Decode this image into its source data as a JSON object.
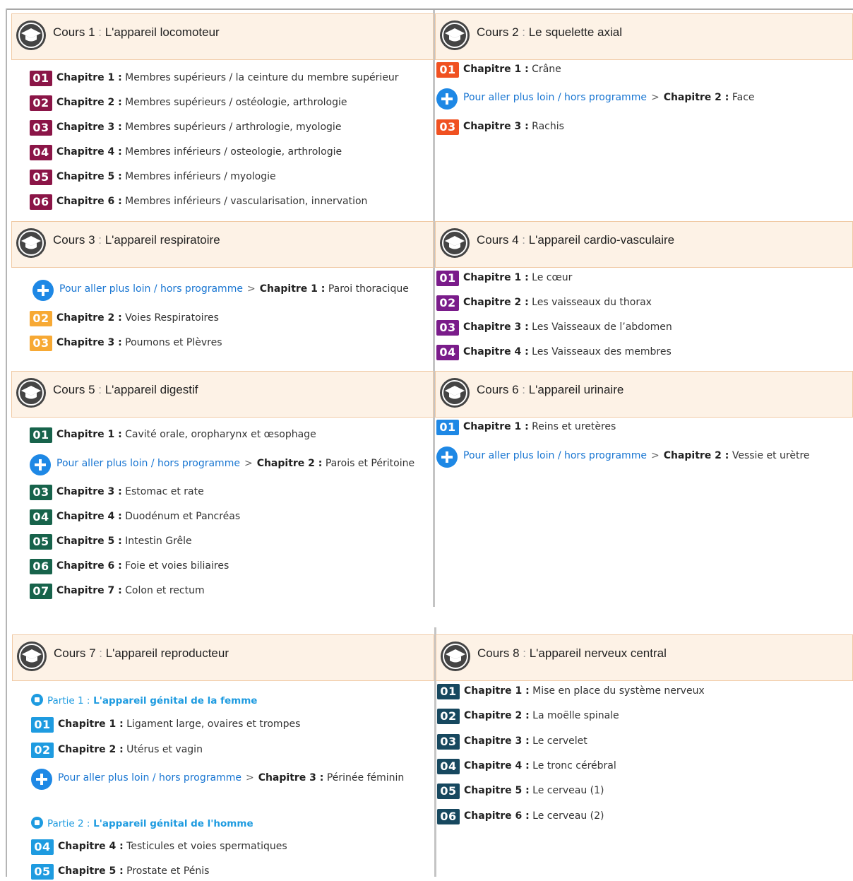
{
  "colors": {
    "maroon": "#8b1547",
    "orange": "#f05121",
    "amber": "#f7a934",
    "purple": "#7a1c8a",
    "green": "#17634b",
    "blue": "#1e88e5",
    "teal": "#17485f",
    "header_bg": "#fdf2e6"
  },
  "link_label": "Pour aller plus loin / hors programme",
  "arrow": ">",
  "cours": [
    {
      "prefix": "Cours 1",
      "title": "L'appareil locomoteur",
      "rows": [
        {
          "num": "01",
          "chap": "Chapitre 1 :",
          "text": "Membres supérieurs / la ceinture du membre supérieur"
        },
        {
          "num": "02",
          "chap": "Chapitre 2 :",
          "text": "Membres supérieurs / ostéologie, arthrologie"
        },
        {
          "num": "03",
          "chap": "Chapitre 3 :",
          "text": "Membres supérieurs / arthrologie, myologie"
        },
        {
          "num": "04",
          "chap": "Chapitre 4 :",
          "text": "Membres inférieurs / osteologie, arthrologie"
        },
        {
          "num": "05",
          "chap": "Chapitre 5 :",
          "text": "Membres inférieurs / myologie"
        },
        {
          "num": "06",
          "chap": "Chapitre 6 :",
          "text": "Membres inférieurs / vascularisation, innervation"
        }
      ]
    },
    {
      "prefix": "Cours 2",
      "title": "Le squelette axial",
      "rows": [
        {
          "num": "01",
          "chap": "Chapitre 1 :",
          "text": "Crâne"
        },
        {
          "num": "",
          "chap": "Chapitre 2 :",
          "text": "Face"
        },
        {
          "num": "03",
          "chap": "Chapitre 3 :",
          "text": "Rachis"
        }
      ]
    },
    {
      "prefix": "Cours 3",
      "title": "L'appareil respiratoire",
      "rows": [
        {
          "num": "",
          "chap": "Chapitre 1 :",
          "text": "Paroi thoracique"
        },
        {
          "num": "02",
          "chap": "Chapitre 2 :",
          "text": "Voies Respiratoires"
        },
        {
          "num": "03",
          "chap": "Chapitre 3 :",
          "text": "Poumons et Plèvres"
        }
      ]
    },
    {
      "prefix": "Cours 4",
      "title": "L'appareil cardio-vasculaire",
      "rows": [
        {
          "num": "01",
          "chap": "Chapitre 1 :",
          "text": "Le cœur"
        },
        {
          "num": "02",
          "chap": "Chapitre 2 :",
          "text": "Les vaisseaux du thorax"
        },
        {
          "num": "03",
          "chap": "Chapitre 3 :",
          "text": "Les Vaisseaux de l’abdomen"
        },
        {
          "num": "04",
          "chap": "Chapitre 4 :",
          "text": "Les Vaisseaux des membres"
        }
      ]
    },
    {
      "prefix": "Cours 5",
      "title": "L'appareil digestif",
      "rows": [
        {
          "num": "01",
          "chap": "Chapitre 1 :",
          "text": "Cavité orale, oropharynx et œsophage"
        },
        {
          "num": "",
          "chap": "Chapitre 2 :",
          "text": "Parois et Péritoine"
        },
        {
          "num": "03",
          "chap": "Chapitre 3 :",
          "text": "Estomac et rate"
        },
        {
          "num": "04",
          "chap": "Chapitre 4 :",
          "text": "Duodénum et Pancréas"
        },
        {
          "num": "05",
          "chap": "Chapitre 5 :",
          "text": "Intestin Grêle"
        },
        {
          "num": "06",
          "chap": "Chapitre 6 :",
          "text": "Foie et voies biliaires"
        },
        {
          "num": "07",
          "chap": "Chapitre 7 :",
          "text": "Colon et rectum"
        }
      ]
    },
    {
      "prefix": "Cours 6",
      "title": "L'appareil urinaire",
      "rows": [
        {
          "num": "01",
          "chap": "Chapitre 1 :",
          "text": "Reins et uretères"
        },
        {
          "num": "",
          "chap": "Chapitre 2 :",
          "text": "Vessie et urètre"
        }
      ]
    },
    {
      "prefix": "Cours 7",
      "title": "L'appareil reproducteur",
      "parties": [
        {
          "label": "Partie 1 :",
          "text": "L'appareil génital de la femme"
        },
        {
          "label": "Partie 2 :",
          "text": "L'appareil génital de l'homme"
        }
      ],
      "rows": [
        {
          "num": "01",
          "chap": "Chapitre 1 :",
          "text": "Ligament large, ovaires et trompes"
        },
        {
          "num": "02",
          "chap": "Chapitre 2 :",
          "text": "Utérus et vagin"
        },
        {
          "num": "",
          "chap": "Chapitre 3 :",
          "text": "Périnée féminin"
        },
        {
          "num": "04",
          "chap": "Chapitre 4 :",
          "text": "Testicules et voies spermatiques"
        },
        {
          "num": "05",
          "chap": "Chapitre 5 :",
          "text": "Prostate et Pénis"
        }
      ]
    },
    {
      "prefix": "Cours 8",
      "title": "L'appareil nerveux central",
      "rows": [
        {
          "num": "01",
          "chap": "Chapitre 1 :",
          "text": "Mise en place du système nerveux"
        },
        {
          "num": "02",
          "chap": "Chapitre 2 :",
          "text": "La moëlle spinale"
        },
        {
          "num": "03",
          "chap": "Chapitre 3 :",
          "text": "Le cervelet"
        },
        {
          "num": "04",
          "chap": "Chapitre 4 :",
          "text": "Le tronc cérébral"
        },
        {
          "num": "05",
          "chap": "Chapitre 5 :",
          "text": "Le cerveau (1)"
        },
        {
          "num": "06",
          "chap": "Chapitre 6 :",
          "text": "Le cerveau (2)"
        }
      ]
    }
  ]
}
